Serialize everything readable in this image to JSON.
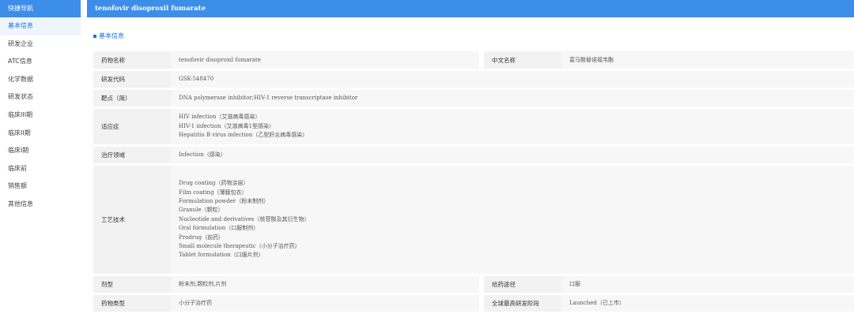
{
  "sidebar": {
    "header": "快捷导航",
    "items": [
      "基本信息",
      "研发企业",
      "ATC信息",
      "化学数据",
      "研发状态",
      "临床III期",
      "临床II期",
      "临床I期",
      "临床前",
      "销售额",
      "其他信息"
    ],
    "active_index": 0
  },
  "page": {
    "title": "tenofovir disoproxil fumarate",
    "section_title": "基本信息"
  },
  "info": {
    "drug_name_label": "药物名称",
    "drug_name": "tenofovir disoproxil fumarate",
    "cn_name_label": "中文名称",
    "cn_name": "富马酸替诺福韦酯",
    "code_label": "研发代码",
    "code": "GSK-548470",
    "target_label": "靶点（简）",
    "target": "DNA polymerase inhibitor;HIV-1 reverse transcriptase inhibitor",
    "indication_label": "适应症",
    "indications": [
      "HIV infection（艾滋病毒感染）",
      "HIV-1 infection（艾滋病毒1型感染）",
      "Hepatitis B virus infection（乙型肝炎病毒感染）"
    ],
    "area_label": "治疗领域",
    "area": "Infection（感染）",
    "tech_label": "工艺技术",
    "techs": [
      "Drug coating（药物涂层）",
      "Film coating（薄膜包衣）",
      "Formulation powder（粉末制剂）",
      "Granule（颗粒）",
      "Nucleotide and derivatives（核苷酸及其衍生物）",
      "Oral formulation（口服制剂）",
      "Prodrug（前药）",
      "Small molecule therapeutic（小分子治疗药）",
      "Tablet formulation（口服片剂）"
    ],
    "dosage_label": "剂型",
    "dosage": "粉末剂,颗粒剂,片剂",
    "route_label": "给药途径",
    "route": "口服",
    "type_label": "药物类型",
    "type": "小分子治疗药",
    "phase_label": "全球最高研发阶段",
    "phase": "Launched（已上市）"
  }
}
